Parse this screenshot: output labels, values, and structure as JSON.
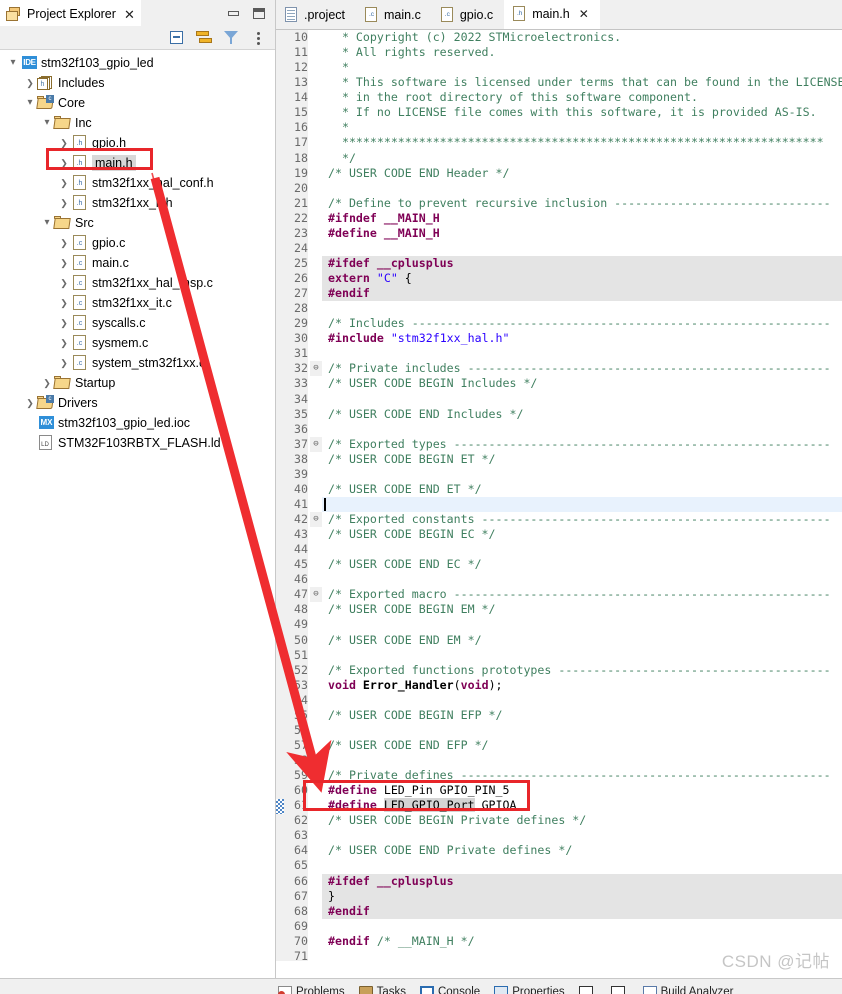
{
  "project_explorer": {
    "title": "Project Explorer",
    "tab_icon": "project-explorer-icon",
    "close_label": "✕",
    "window_buttons": {
      "minimize": "minimize",
      "maximize": "maximize"
    },
    "toolbar": [
      {
        "name": "collapse-all-icon",
        "tooltip": "Collapse All"
      },
      {
        "name": "link-with-editor-icon",
        "tooltip": "Link with Editor"
      },
      {
        "name": "filter-icon",
        "tooltip": "Filters"
      },
      {
        "name": "view-menu-icon",
        "tooltip": "View Menu"
      }
    ],
    "tree": [
      {
        "label": "stm32f103_gpio_led",
        "indent": 0,
        "twisty": "⌄",
        "icon": "ide-project-icon",
        "selected": false
      },
      {
        "label": "Includes",
        "indent": 1,
        "twisty": "›",
        "icon": "includes-icon",
        "selected": false
      },
      {
        "label": "Core",
        "indent": 1,
        "twisty": "⌄",
        "icon": "source-folder-icon",
        "selected": false
      },
      {
        "label": "Inc",
        "indent": 2,
        "twisty": "⌄",
        "icon": "folder-icon",
        "selected": false
      },
      {
        "label": "gpio.h",
        "indent": 3,
        "twisty": "›",
        "icon": "h-file-icon",
        "selected": false
      },
      {
        "label": "main.h",
        "indent": 3,
        "twisty": "›",
        "icon": "h-file-icon",
        "selected": true
      },
      {
        "label": "stm32f1xx_hal_conf.h",
        "indent": 3,
        "twisty": "›",
        "icon": "h-file-icon",
        "selected": false
      },
      {
        "label": "stm32f1xx_it.h",
        "indent": 3,
        "twisty": "›",
        "icon": "h-file-icon",
        "selected": false
      },
      {
        "label": "Src",
        "indent": 2,
        "twisty": "⌄",
        "icon": "folder-icon",
        "selected": false
      },
      {
        "label": "gpio.c",
        "indent": 3,
        "twisty": "›",
        "icon": "c-file-icon",
        "selected": false
      },
      {
        "label": "main.c",
        "indent": 3,
        "twisty": "›",
        "icon": "c-file-icon",
        "selected": false
      },
      {
        "label": "stm32f1xx_hal_msp.c",
        "indent": 3,
        "twisty": "›",
        "icon": "c-file-icon",
        "selected": false
      },
      {
        "label": "stm32f1xx_it.c",
        "indent": 3,
        "twisty": "›",
        "icon": "c-file-icon",
        "selected": false
      },
      {
        "label": "syscalls.c",
        "indent": 3,
        "twisty": "›",
        "icon": "c-file-icon",
        "selected": false
      },
      {
        "label": "sysmem.c",
        "indent": 3,
        "twisty": "›",
        "icon": "c-file-icon",
        "selected": false
      },
      {
        "label": "system_stm32f1xx.c",
        "indent": 3,
        "twisty": "›",
        "icon": "c-file-icon",
        "selected": false
      },
      {
        "label": "Startup",
        "indent": 2,
        "twisty": "›",
        "icon": "folder-icon",
        "selected": false
      },
      {
        "label": "Drivers",
        "indent": 1,
        "twisty": "›",
        "icon": "source-folder-icon",
        "selected": false
      },
      {
        "label": "stm32f103_gpio_led.ioc",
        "indent": 1,
        "twisty": "",
        "icon": "ioc-file-icon",
        "selected": false
      },
      {
        "label": "STM32F103RBTX_FLASH.ld",
        "indent": 1,
        "twisty": "",
        "icon": "ld-file-icon",
        "selected": false
      }
    ]
  },
  "editor": {
    "tabs": [
      {
        "label": ".project",
        "icon": "xml-file-icon",
        "active": false,
        "closable": false
      },
      {
        "label": "main.c",
        "icon": "c-file-icon",
        "active": false,
        "closable": false
      },
      {
        "label": "gpio.c",
        "icon": "c-file-icon",
        "active": false,
        "closable": false
      },
      {
        "label": "main.h",
        "icon": "h-file-icon",
        "active": true,
        "closable": true,
        "close_label": "✕"
      }
    ],
    "first_line_number": 10,
    "cursor_line": 41,
    "changed_line": 61,
    "lines": [
      {
        "n": 10,
        "fold": "",
        "bg": "",
        "tokens": [
          {
            "t": "  * Copyright (c) 2022 STMicroelectronics.",
            "c": "cm"
          }
        ]
      },
      {
        "n": 11,
        "fold": "",
        "bg": "",
        "tokens": [
          {
            "t": "  * All rights reserved.",
            "c": "cm"
          }
        ]
      },
      {
        "n": 12,
        "fold": "",
        "bg": "",
        "tokens": [
          {
            "t": "  *",
            "c": "cm"
          }
        ]
      },
      {
        "n": 13,
        "fold": "",
        "bg": "",
        "tokens": [
          {
            "t": "  * This software is licensed under terms that can be found in the LICENSE f",
            "c": "cm"
          }
        ]
      },
      {
        "n": 14,
        "fold": "",
        "bg": "",
        "tokens": [
          {
            "t": "  * in the root directory of this software component.",
            "c": "cm"
          }
        ]
      },
      {
        "n": 15,
        "fold": "",
        "bg": "",
        "tokens": [
          {
            "t": "  * If no LICENSE file comes with this software, it is provided AS-IS.",
            "c": "cm"
          }
        ]
      },
      {
        "n": 16,
        "fold": "",
        "bg": "",
        "tokens": [
          {
            "t": "  *",
            "c": "cm"
          }
        ]
      },
      {
        "n": 17,
        "fold": "",
        "bg": "",
        "tokens": [
          {
            "t": "  *********************************************************************",
            "c": "cm"
          }
        ]
      },
      {
        "n": 18,
        "fold": "",
        "bg": "",
        "tokens": [
          {
            "t": "  */",
            "c": "cm"
          }
        ]
      },
      {
        "n": 19,
        "fold": "",
        "bg": "",
        "tokens": [
          {
            "t": "/* USER CODE END Header */",
            "c": "cm"
          }
        ]
      },
      {
        "n": 20,
        "fold": "",
        "bg": "",
        "tokens": [
          {
            "t": "",
            "c": "pl"
          }
        ]
      },
      {
        "n": 21,
        "fold": "",
        "bg": "",
        "tokens": [
          {
            "t": "/* Define to prevent recursive inclusion -------------------------------",
            "c": "cm"
          }
        ]
      },
      {
        "n": 22,
        "fold": "",
        "bg": "",
        "tokens": [
          {
            "t": "#ifndef __MAIN_H",
            "c": "pp"
          }
        ]
      },
      {
        "n": 23,
        "fold": "",
        "bg": "",
        "tokens": [
          {
            "t": "#define __MAIN_H",
            "c": "pp"
          }
        ]
      },
      {
        "n": 24,
        "fold": "",
        "bg": "",
        "tokens": [
          {
            "t": "",
            "c": "pl"
          }
        ]
      },
      {
        "n": 25,
        "fold": "",
        "bg": "grey",
        "tokens": [
          {
            "t": "#ifdef __cplusplus",
            "c": "pp"
          }
        ]
      },
      {
        "n": 26,
        "fold": "",
        "bg": "grey",
        "tokens": [
          {
            "t": "extern ",
            "c": "kw"
          },
          {
            "t": "\"C\"",
            "c": "str"
          },
          {
            "t": " {",
            "c": "pl"
          }
        ]
      },
      {
        "n": 27,
        "fold": "",
        "bg": "grey",
        "tokens": [
          {
            "t": "#endif",
            "c": "pp"
          }
        ]
      },
      {
        "n": 28,
        "fold": "",
        "bg": "",
        "tokens": [
          {
            "t": "",
            "c": "pl"
          }
        ]
      },
      {
        "n": 29,
        "fold": "",
        "bg": "",
        "tokens": [
          {
            "t": "/* Includes ------------------------------------------------------------",
            "c": "cm"
          }
        ]
      },
      {
        "n": 30,
        "fold": "",
        "bg": "",
        "tokens": [
          {
            "t": "#include ",
            "c": "pp"
          },
          {
            "t": "\"stm32f1xx_hal.h\"",
            "c": "str"
          }
        ]
      },
      {
        "n": 31,
        "fold": "",
        "bg": "",
        "tokens": [
          {
            "t": "",
            "c": "pl"
          }
        ]
      },
      {
        "n": 32,
        "fold": "⊖",
        "bg": "",
        "tokens": [
          {
            "t": "/* Private includes ----------------------------------------------------",
            "c": "cm"
          }
        ]
      },
      {
        "n": 33,
        "fold": "",
        "bg": "",
        "tokens": [
          {
            "t": "/* USER CODE BEGIN Includes */",
            "c": "cm"
          }
        ]
      },
      {
        "n": 34,
        "fold": "",
        "bg": "",
        "tokens": [
          {
            "t": "",
            "c": "pl"
          }
        ]
      },
      {
        "n": 35,
        "fold": "",
        "bg": "",
        "tokens": [
          {
            "t": "/* USER CODE END Includes */",
            "c": "cm"
          }
        ]
      },
      {
        "n": 36,
        "fold": "",
        "bg": "",
        "tokens": [
          {
            "t": "",
            "c": "pl"
          }
        ]
      },
      {
        "n": 37,
        "fold": "⊖",
        "bg": "",
        "tokens": [
          {
            "t": "/* Exported types ------------------------------------------------------",
            "c": "cm"
          }
        ]
      },
      {
        "n": 38,
        "fold": "",
        "bg": "",
        "tokens": [
          {
            "t": "/* USER CODE BEGIN ET */",
            "c": "cm"
          }
        ]
      },
      {
        "n": 39,
        "fold": "",
        "bg": "",
        "tokens": [
          {
            "t": "",
            "c": "pl"
          }
        ]
      },
      {
        "n": 40,
        "fold": "",
        "bg": "",
        "tokens": [
          {
            "t": "/* USER CODE END ET */",
            "c": "cm"
          }
        ]
      },
      {
        "n": 41,
        "fold": "",
        "bg": "cursor",
        "tokens": [
          {
            "t": "",
            "c": "pl"
          }
        ]
      },
      {
        "n": 42,
        "fold": "⊖",
        "bg": "",
        "tokens": [
          {
            "t": "/* Exported constants --------------------------------------------------",
            "c": "cm"
          }
        ]
      },
      {
        "n": 43,
        "fold": "",
        "bg": "",
        "tokens": [
          {
            "t": "/* USER CODE BEGIN EC */",
            "c": "cm"
          }
        ]
      },
      {
        "n": 44,
        "fold": "",
        "bg": "",
        "tokens": [
          {
            "t": "",
            "c": "pl"
          }
        ]
      },
      {
        "n": 45,
        "fold": "",
        "bg": "",
        "tokens": [
          {
            "t": "/* USER CODE END EC */",
            "c": "cm"
          }
        ]
      },
      {
        "n": 46,
        "fold": "",
        "bg": "",
        "tokens": [
          {
            "t": "",
            "c": "pl"
          }
        ]
      },
      {
        "n": 47,
        "fold": "⊖",
        "bg": "",
        "tokens": [
          {
            "t": "/* Exported macro ------------------------------------------------------",
            "c": "cm"
          }
        ]
      },
      {
        "n": 48,
        "fold": "",
        "bg": "",
        "tokens": [
          {
            "t": "/* USER CODE BEGIN EM */",
            "c": "cm"
          }
        ]
      },
      {
        "n": 49,
        "fold": "",
        "bg": "",
        "tokens": [
          {
            "t": "",
            "c": "pl"
          }
        ]
      },
      {
        "n": 50,
        "fold": "",
        "bg": "",
        "tokens": [
          {
            "t": "/* USER CODE END EM */",
            "c": "cm"
          }
        ]
      },
      {
        "n": 51,
        "fold": "",
        "bg": "",
        "tokens": [
          {
            "t": "",
            "c": "pl"
          }
        ]
      },
      {
        "n": 52,
        "fold": "",
        "bg": "",
        "tokens": [
          {
            "t": "/* Exported functions prototypes ---------------------------------------",
            "c": "cm"
          }
        ]
      },
      {
        "n": 53,
        "fold": "",
        "bg": "",
        "tokens": [
          {
            "t": "void ",
            "c": "kw"
          },
          {
            "t": "Error_Handler",
            "c": "fn"
          },
          {
            "t": "(",
            "c": "pl"
          },
          {
            "t": "void",
            "c": "kw"
          },
          {
            "t": ");",
            "c": "pl"
          }
        ]
      },
      {
        "n": 54,
        "fold": "",
        "bg": "",
        "tokens": [
          {
            "t": "",
            "c": "pl"
          }
        ]
      },
      {
        "n": 55,
        "fold": "",
        "bg": "",
        "tokens": [
          {
            "t": "/* USER CODE BEGIN EFP */",
            "c": "cm"
          }
        ]
      },
      {
        "n": 56,
        "fold": "",
        "bg": "",
        "tokens": [
          {
            "t": "",
            "c": "pl"
          }
        ]
      },
      {
        "n": 57,
        "fold": "",
        "bg": "",
        "tokens": [
          {
            "t": "/* USER CODE END EFP */",
            "c": "cm"
          }
        ]
      },
      {
        "n": 58,
        "fold": "",
        "bg": "",
        "tokens": [
          {
            "t": "",
            "c": "pl"
          }
        ]
      },
      {
        "n": 59,
        "fold": "",
        "bg": "",
        "tokens": [
          {
            "t": "/* Private defines -----------------------------------------------------",
            "c": "cm"
          }
        ]
      },
      {
        "n": 60,
        "fold": "",
        "bg": "",
        "tokens": [
          {
            "t": "#define ",
            "c": "pp"
          },
          {
            "t": "LED_Pin GPIO_PIN_5",
            "c": "pl"
          }
        ]
      },
      {
        "n": 61,
        "fold": "",
        "bg": "",
        "tokens": [
          {
            "t": "#define ",
            "c": "pp"
          },
          {
            "t": "LED_GPIO_Port",
            "c": "occ"
          },
          {
            "t": " GPIOA",
            "c": "pl"
          }
        ]
      },
      {
        "n": 62,
        "fold": "",
        "bg": "",
        "tokens": [
          {
            "t": "/* USER CODE BEGIN Private defines */",
            "c": "cm"
          }
        ]
      },
      {
        "n": 63,
        "fold": "",
        "bg": "",
        "tokens": [
          {
            "t": "",
            "c": "pl"
          }
        ]
      },
      {
        "n": 64,
        "fold": "",
        "bg": "",
        "tokens": [
          {
            "t": "/* USER CODE END Private defines */",
            "c": "cm"
          }
        ]
      },
      {
        "n": 65,
        "fold": "",
        "bg": "",
        "tokens": [
          {
            "t": "",
            "c": "pl"
          }
        ]
      },
      {
        "n": 66,
        "fold": "",
        "bg": "grey",
        "tokens": [
          {
            "t": "#ifdef __cplusplus",
            "c": "pp"
          }
        ]
      },
      {
        "n": 67,
        "fold": "",
        "bg": "grey",
        "tokens": [
          {
            "t": "}",
            "c": "pl"
          }
        ]
      },
      {
        "n": 68,
        "fold": "",
        "bg": "grey",
        "tokens": [
          {
            "t": "#endif",
            "c": "pp"
          }
        ]
      },
      {
        "n": 69,
        "fold": "",
        "bg": "",
        "tokens": [
          {
            "t": "",
            "c": "pl"
          }
        ]
      },
      {
        "n": 70,
        "fold": "",
        "bg": "",
        "tokens": [
          {
            "t": "#endif ",
            "c": "pp"
          },
          {
            "t": "/* __MAIN_H */",
            "c": "cm"
          }
        ]
      },
      {
        "n": 71,
        "fold": "",
        "bg": "",
        "tokens": [
          {
            "t": "",
            "c": "pl"
          }
        ]
      }
    ],
    "hscroll": {
      "left_arrow": "‹"
    }
  },
  "annotations": {
    "highlight_color": "#e8262a",
    "tree_box_target": "main.h",
    "code_box_target": "LED_Pin / LED_GPIO_Port defines",
    "arrow": "red-arrow-from-mainh-to-defines"
  },
  "bottom_views": [
    {
      "label": "Problems",
      "icon": "problems-icon"
    },
    {
      "label": "Tasks",
      "icon": "tasks-icon"
    },
    {
      "label": "Console",
      "icon": "console-icon"
    },
    {
      "label": "Properties",
      "icon": "properties-icon"
    },
    {
      "label": "",
      "icon": "square-icon"
    },
    {
      "label": "",
      "icon": "list-icon"
    },
    {
      "label": "Build Analyzer",
      "icon": "build-analyzer-icon"
    }
  ],
  "watermark": {
    "text": "CSDN @记帖"
  }
}
